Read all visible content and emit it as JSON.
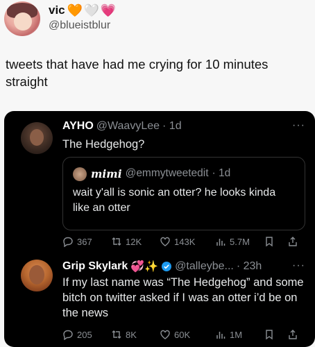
{
  "outer": {
    "name": "vic",
    "handle": "@blueistblur",
    "hearts": [
      "🧡",
      "🤍",
      "💗"
    ],
    "text": "tweets that have had me crying for 10 minutes straight"
  },
  "tweet1": {
    "name": "AYHO",
    "handle": "@WaavyLee",
    "time": "· 1d",
    "text": "The Hedgehog?",
    "quote": {
      "name": "mimi",
      "handle": "@emmytweetedit",
      "time": "· 1d",
      "text": "wait y'all is sonic an otter? he looks kinda like an otter"
    },
    "stats": {
      "replies": "367",
      "retweets": "12K",
      "likes": "143K",
      "views": "5.7M"
    }
  },
  "tweet2": {
    "name": "Grip Skylark",
    "emoji": "💞✨",
    "handle": "@talleybe...",
    "time": "· 23h",
    "text": "If my last name was “The Hedgehog” and some bitch on twitter asked if I was an otter i’d be on the news",
    "stats": {
      "replies": "205",
      "retweets": "8K",
      "likes": "60K",
      "views": "1M"
    }
  },
  "more_label": "···",
  "colors": {
    "card_bg": "#000000",
    "muted": "#8b8f94",
    "verified": "#1d9bf0"
  }
}
